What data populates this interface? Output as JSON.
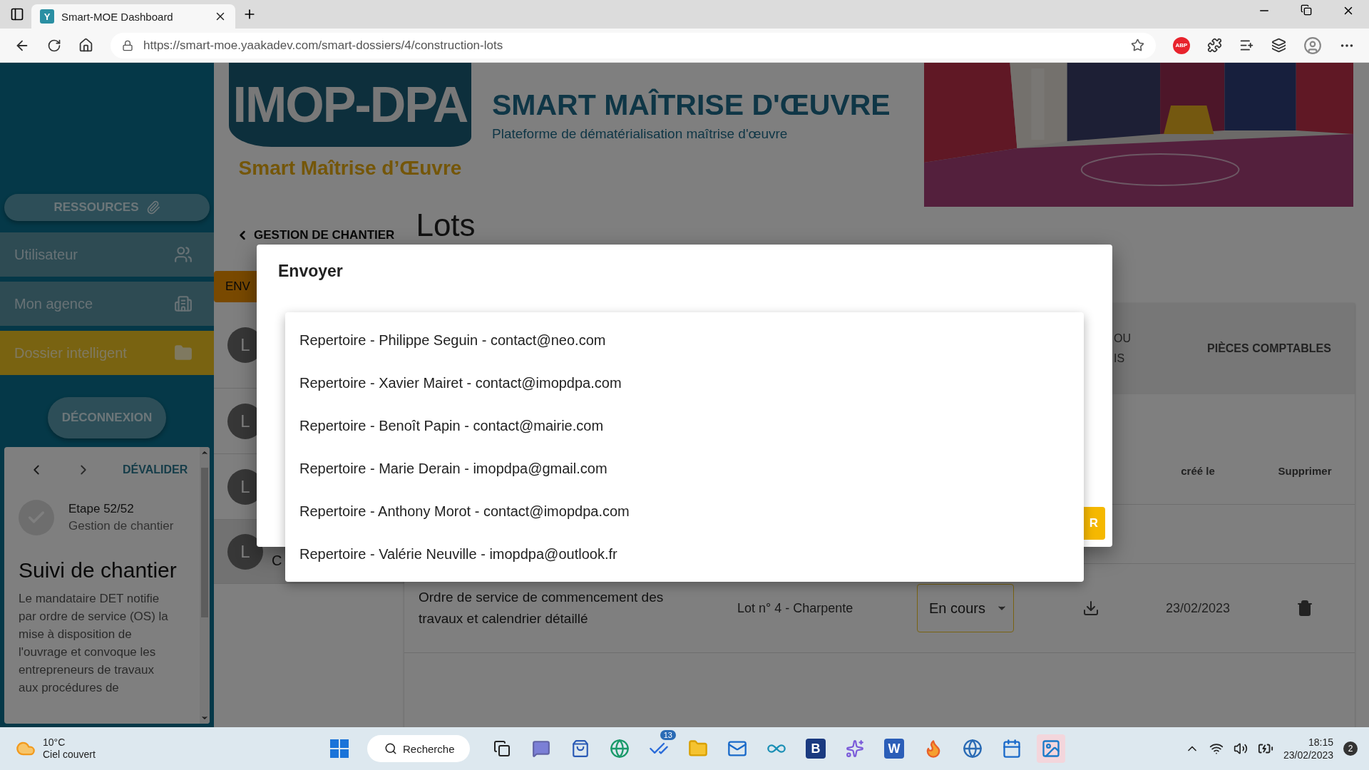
{
  "browser": {
    "favicon": "Y",
    "tab_title": "Smart-MOE Dashboard",
    "url": "https://smart-moe.yaakadev.com/smart-dossiers/4/construction-lots",
    "abp": "ABP"
  },
  "sidebar": {
    "resources": "RESSOURCES",
    "items": [
      {
        "label": "Utilisateur",
        "kind": "users",
        "selected": false
      },
      {
        "label": "Mon agence",
        "kind": "building",
        "selected": false
      },
      {
        "label": "Dossier intelligent",
        "kind": "folder",
        "selected": true
      }
    ],
    "logout": "DÉCONNEXION",
    "step_card": {
      "devalidate": "DÉVALIDER",
      "step": "Etape 52/52",
      "phase": "Gestion de chantier",
      "title": "Suivi de chantier",
      "description": "Le mandataire DET notifie par ordre de service (OS) la mise à disposition de l'ouvrage et convoque les entrepreneurs de travaux aux procédures de"
    }
  },
  "header": {
    "logo_text": "IMOP-DPA",
    "logo_tagline": "Smart Maîtrise d’Œuvre",
    "title": "SMART MAÎTRISE D'ŒUVRE",
    "subtitle": "Plateforme de dématérialisation maîtrise d'œuvre"
  },
  "content": {
    "back": "GESTION DE CHANTIER",
    "page_title": "Lots",
    "send_button": "ENV",
    "lots": [
      {
        "avatar": "L",
        "selected": false
      },
      {
        "avatar": "L",
        "selected": false
      },
      {
        "avatar": "L",
        "selected": false
      },
      {
        "avatar": "L",
        "text": "C",
        "selected": true
      }
    ],
    "table": {
      "header_fragment": "OU IS",
      "header_accounting": "PIÈCES COMPTABLES",
      "col_created": "créé le",
      "col_delete": "Supprimer",
      "rows": [
        {
          "document": "Ordre de service de commencement des travaux et calendrier détaillé",
          "lot": "Lot n° 4 - Charpente",
          "status": "En cours",
          "date": "23/02/2023"
        }
      ]
    }
  },
  "modal": {
    "title": "Envoyer",
    "button_fragment": "R",
    "options": [
      "Repertoire - Philippe Seguin - contact@neo.com",
      "Repertoire - Xavier Mairet - contact@imopdpa.com",
      "Repertoire - Benoît Papin - contact@mairie.com",
      "Repertoire - Marie Derain - imopdpa@gmail.com",
      "Repertoire - Anthony Morot - contact@imopdpa.com",
      "Repertoire - Valérie Neuville - imopdpa@outlook.fr"
    ]
  },
  "taskbar": {
    "temperature": "10°C",
    "weather": "Ciel couvert",
    "search": "Recherche",
    "todo_badge": "13",
    "booking_letter": "B",
    "word_letter": "W",
    "time": "18:15",
    "date": "23/02/2023",
    "notifications": "2"
  }
}
